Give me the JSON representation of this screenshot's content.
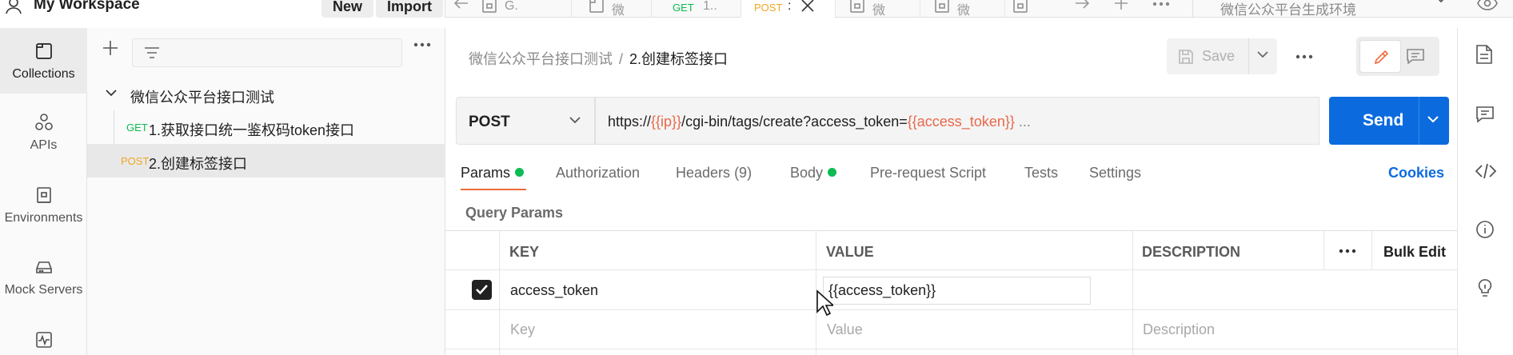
{
  "workspace": {
    "title": "My Workspace",
    "new_label": "New",
    "import_label": "Import"
  },
  "rail": {
    "items": [
      {
        "label": "Collections",
        "icon": "collections-icon"
      },
      {
        "label": "APIs",
        "icon": "apis-icon"
      },
      {
        "label": "Environments",
        "icon": "environments-icon"
      },
      {
        "label": "Mock Servers",
        "icon": "mock-servers-icon"
      },
      {
        "label": "",
        "icon": "monitors-icon"
      }
    ]
  },
  "tree": {
    "collection": "微信公众平台接口测试",
    "requests": [
      {
        "method": "GET",
        "name": "1.获取接口统一鉴权码token接口",
        "method_color": "#0cbb52"
      },
      {
        "method": "POST",
        "name": "2.创建标签接口",
        "method_color": "#f2a623"
      }
    ]
  },
  "tabs": [
    {
      "method": "",
      "label": "G."
    },
    {
      "method": "",
      "label": "微"
    },
    {
      "method": "GET",
      "label": "1.."
    },
    {
      "method": "POST",
      "label": ":"
    },
    {
      "method": "",
      "label": "微"
    },
    {
      "method": "",
      "label": "微"
    },
    {
      "method": "",
      "label": ""
    }
  ],
  "environment": {
    "selected": "微信公众平台生成环境"
  },
  "breadcrumb": {
    "parent": "微信公众平台接口测试",
    "separator": "/",
    "current": "2.创建标签接口"
  },
  "toolbar": {
    "save_label": "Save"
  },
  "request": {
    "method": "POST",
    "url_prefix": "https://",
    "url_var1": "{{ip}}",
    "url_mid": "/cgi-bin/tags/create?access_token=",
    "url_var2": "{{access_token}}",
    "url_suffix": " ...",
    "send_label": "Send"
  },
  "request_tabs": {
    "params": "Params",
    "authorization": "Authorization",
    "headers": "Headers",
    "headers_count": "(9)",
    "body": "Body",
    "pre_request": "Pre-request Script",
    "tests": "Tests",
    "settings": "Settings",
    "cookies": "Cookies"
  },
  "query_params": {
    "title": "Query Params",
    "columns": {
      "key": "KEY",
      "value": "VALUE",
      "description": "DESCRIPTION",
      "bulk_edit": "Bulk Edit"
    },
    "rows": [
      {
        "checked": true,
        "key": "access_token",
        "value": "{{access_token}}",
        "description": ""
      }
    ],
    "placeholders": {
      "key": "Key",
      "value": "Value",
      "description": "Description"
    }
  },
  "colors": {
    "accent": "#0b6bde",
    "active_tab_underline": "#f26b3a",
    "variable": "#e8684a",
    "status_dot": "#0cbb52"
  }
}
